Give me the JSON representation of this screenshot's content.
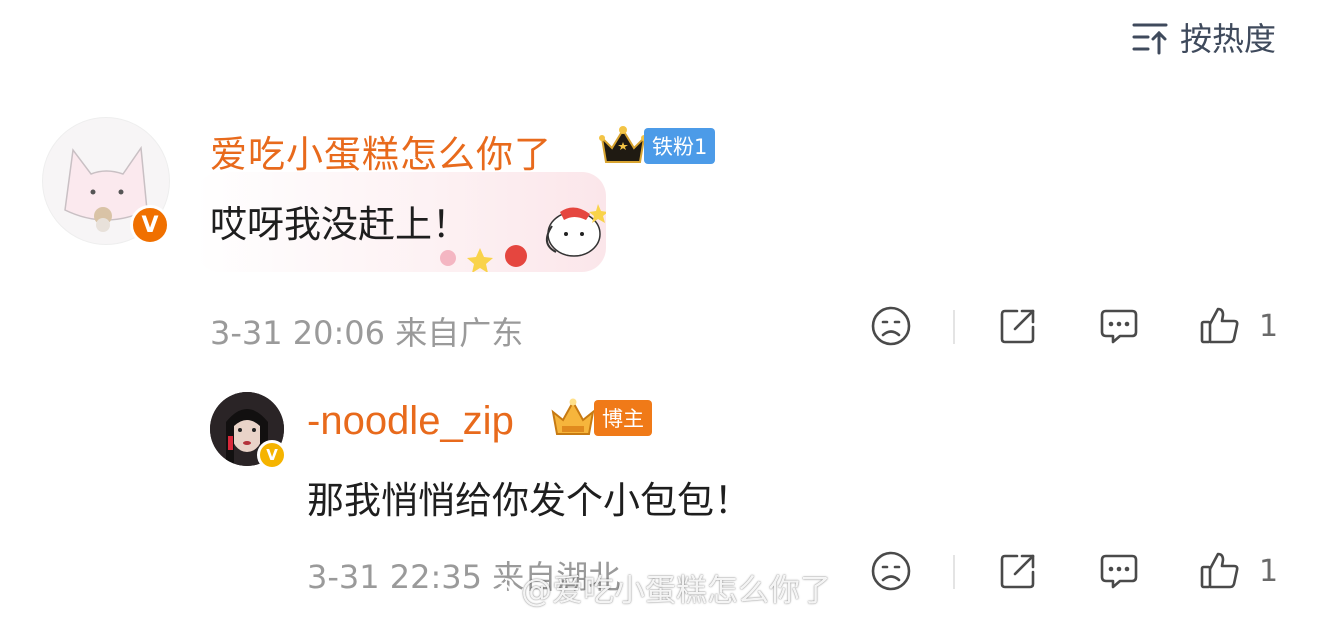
{
  "sort": {
    "label": "按热度"
  },
  "comments": [
    {
      "username": "爱吃小蛋糕怎么你了",
      "badge": "铁粉1",
      "text": "哎呀我没赶上！",
      "meta": "3-31 20:06  来自广东",
      "likes": "1"
    },
    {
      "username": "-noodle_zip",
      "badge": "博主",
      "text": "那我悄悄给你发个小包包！",
      "meta": "3-31 22:35  来自湖北",
      "likes": "1"
    }
  ],
  "watermark": "@爱吃小蛋糕怎么你了",
  "colors": {
    "username": "#e86a1c",
    "fan_badge": "#4c9be8",
    "owner_badge": "#f07a18",
    "meta": "#9a9a9a"
  }
}
